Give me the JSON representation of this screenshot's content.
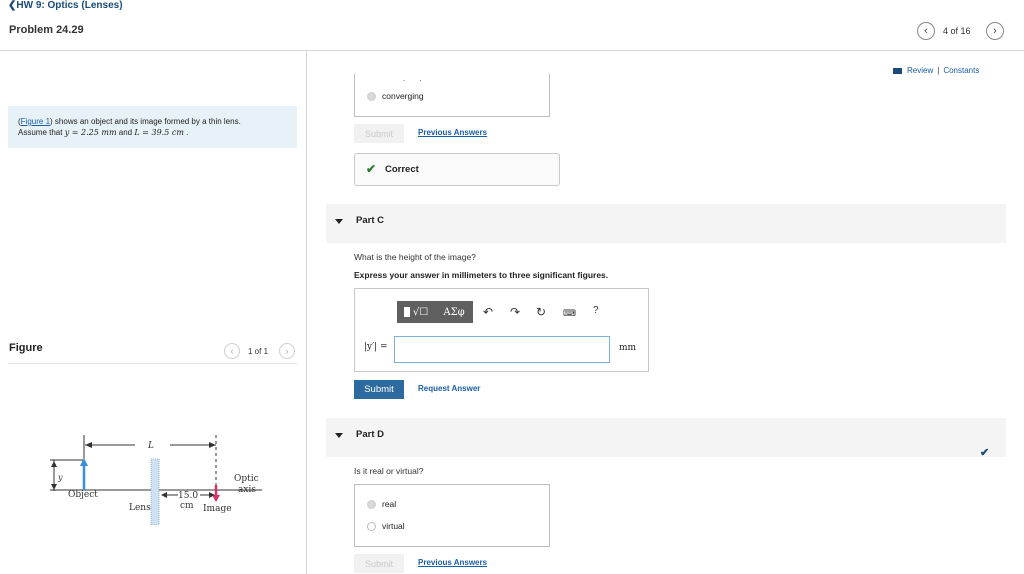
{
  "header": {
    "back_label": "HW 9: Optics (Lenses)",
    "problem_title": "Problem 24.29",
    "page_indicator": "4 of 16"
  },
  "links": {
    "review": "Review",
    "separator": "|",
    "constants": "Constants"
  },
  "statement": {
    "figure_link": "Figure 1",
    "line1_rest": ") shows an object and its image formed by a thin lens.",
    "line2_prefix": "Assume that",
    "y_expr": "y = 2.25 mm",
    "and_word": "and",
    "l_expr": "L = 39.5 cm",
    "end": "."
  },
  "figure": {
    "label": "Figure",
    "count": "1 of 1",
    "labels": {
      "L": "L",
      "y": "y",
      "object": "Object",
      "lens": "Lens",
      "dist_value": "15.0",
      "dist_unit": "cm",
      "image": "Image",
      "optic": "Optic",
      "axis": "axis"
    }
  },
  "part_b": {
    "options": [
      "converging"
    ],
    "submit_label": "Submit",
    "previous_answers": "Previous Answers",
    "correct_label": "Correct"
  },
  "part_c": {
    "title": "Part C",
    "question": "What is the height of the image?",
    "instruction": "Express your answer in millimeters to three significant figures.",
    "toolbar": {
      "greek": "ΑΣφ",
      "help": "?"
    },
    "var_label": "|y′| =",
    "input_value": "",
    "unit": "mm",
    "submit_label": "Submit",
    "request_answer": "Request Answer"
  },
  "part_d": {
    "title": "Part D",
    "question": "Is it real or virtual?",
    "options": [
      "real",
      "virtual"
    ],
    "selected": "real",
    "submit_label": "Submit",
    "previous_answers": "Previous Answers"
  },
  "colors": {
    "accent": "#2d6a9f",
    "link": "#1a5ea8",
    "correct": "#2e7d32",
    "statement_bg": "#e7f2f8"
  }
}
